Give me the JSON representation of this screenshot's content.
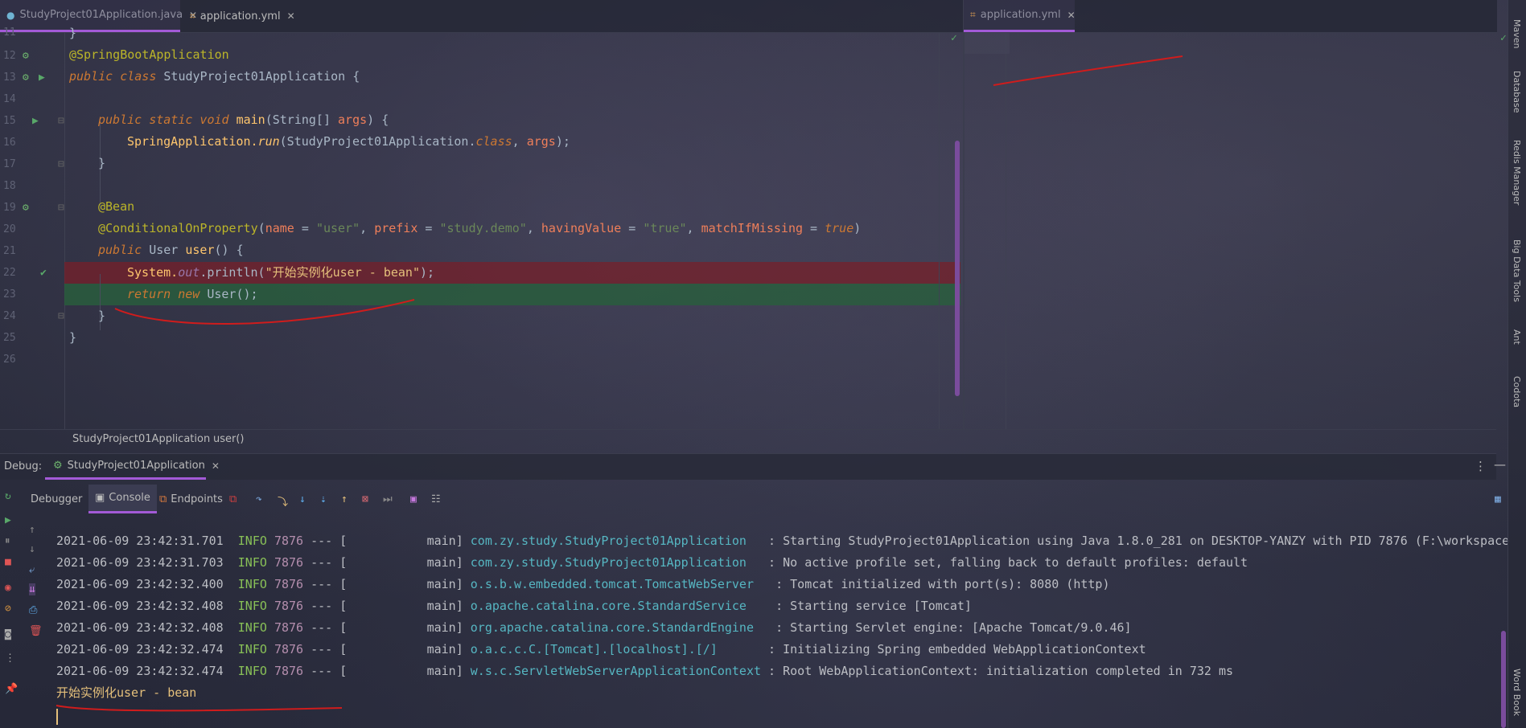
{
  "editor_tabs": [
    {
      "label": "StudyProject01Application.java",
      "active": true,
      "icon": "spring-class-icon"
    },
    {
      "label": "application.yml",
      "active": false,
      "icon": "yaml-file-icon"
    }
  ],
  "right_tab": {
    "label": "application.yml",
    "active": true,
    "icon": "yaml-file-icon"
  },
  "line_numbers": [
    "11",
    "12",
    "13",
    "14",
    "15",
    "16",
    "17",
    "18",
    "19",
    "20",
    "21",
    "22",
    "23",
    "24",
    "25",
    "26"
  ],
  "code": {
    "l11": "}",
    "l12": "@SpringBootApplication",
    "l13_kw1": "public",
    "l13_kw2": "class",
    "l13_name": "StudyProject01Application {",
    "l15_kw": "public static void",
    "l15_fn": "main",
    "l15_rest1": "(String[] ",
    "l15_param": "args",
    "l15_rest2": ") {",
    "l16_cls": "SpringApplication.",
    "l16_fn": "run",
    "l16_a": "(StudyProject01Application.",
    "l16_class": "class",
    "l16_b": ", ",
    "l16_param": "args",
    "l16_c": ");",
    "l17": "}",
    "l19": "@Bean",
    "l20_ann": "@ConditionalOnProperty",
    "l20_p": "(",
    "l20_n1": "name",
    "l20_eq1": " = ",
    "l20_s1": "\"user\"",
    "l20_c1": ", ",
    "l20_n2": "prefix",
    "l20_eq2": " = ",
    "l20_s2": "\"study.demo\"",
    "l20_c2": ", ",
    "l20_n3": "havingValue",
    "l20_eq3": " = ",
    "l20_s3": "\"true\"",
    "l20_c3": ", ",
    "l20_n4": "matchIfMissing",
    "l20_eq4": " = ",
    "l20_v4": "true",
    "l20_end": ")",
    "l21_kw": "public",
    "l21_type": " User ",
    "l21_fn": "user",
    "l21_rest": "() {",
    "l22_sys": "System.",
    "l22_out": "out",
    "l22_print": ".println(",
    "l22_str": "\"开始实例化user - bean\"",
    "l22_end": ");",
    "l23_kw": "return new",
    "l23_rest": " User();",
    "l24": "}",
    "l25": "}"
  },
  "breadcrumb": {
    "class": "StudyProject01Application",
    "method": "user()"
  },
  "debug": {
    "label": "Debug:",
    "config": "StudyProject01Application",
    "tabs": [
      "Debugger",
      "Console",
      "Endpoints"
    ]
  },
  "console_lines": [
    {
      "ts": "2021-06-09 23:42:31.701",
      "level": "INFO",
      "pid": "7876",
      "sep": "--- [",
      "thread": "main]",
      "logger": "com.zy.study.StudyProject01Application  ",
      "msg": ": Starting StudyProject01Application using Java 1.8.0_281 on DESKTOP-YANZY with PID 7876 (F:\\workspace"
    },
    {
      "ts": "2021-06-09 23:42:31.703",
      "level": "INFO",
      "pid": "7876",
      "sep": "--- [",
      "thread": "main]",
      "logger": "com.zy.study.StudyProject01Application  ",
      "msg": ": No active profile set, falling back to default profiles: default"
    },
    {
      "ts": "2021-06-09 23:42:32.400",
      "level": "INFO",
      "pid": "7876",
      "sep": "--- [",
      "thread": "main]",
      "logger": "o.s.b.w.embedded.tomcat.TomcatWebServer  ",
      "msg": ": Tomcat initialized with port(s): 8080 (http)"
    },
    {
      "ts": "2021-06-09 23:42:32.408",
      "level": "INFO",
      "pid": "7876",
      "sep": "--- [",
      "thread": "main]",
      "logger": "o.apache.catalina.core.StandardService   ",
      "msg": ": Starting service [Tomcat]"
    },
    {
      "ts": "2021-06-09 23:42:32.408",
      "level": "INFO",
      "pid": "7876",
      "sep": "--- [",
      "thread": "main]",
      "logger": "org.apache.catalina.core.StandardEngine  ",
      "msg": ": Starting Servlet engine: [Apache Tomcat/9.0.46]"
    },
    {
      "ts": "2021-06-09 23:42:32.474",
      "level": "INFO",
      "pid": "7876",
      "sep": "--- [",
      "thread": "main]",
      "logger": "o.a.c.c.C.[Tomcat].[localhost].[/]      ",
      "msg": ": Initializing Spring embedded WebApplicationContext"
    },
    {
      "ts": "2021-06-09 23:42:32.474",
      "level": "INFO",
      "pid": "7876",
      "sep": "--- [",
      "thread": "main]",
      "logger": "w.s.c.ServletWebServerApplicationContext",
      "msg": ": Root WebApplicationContext: initialization completed in 732 ms"
    }
  ],
  "console_output": "开始实例化user - bean",
  "right_tools": [
    "Maven",
    "Database",
    "Redis Manager",
    "Big Data Tools",
    "Ant",
    "Codota",
    "Word Book"
  ],
  "colors": {
    "accent": "#a35ad7",
    "breakpoint_line": "#7a1e28",
    "exec_line": "#285f3c",
    "annotation_ink": "#d01c1c"
  }
}
